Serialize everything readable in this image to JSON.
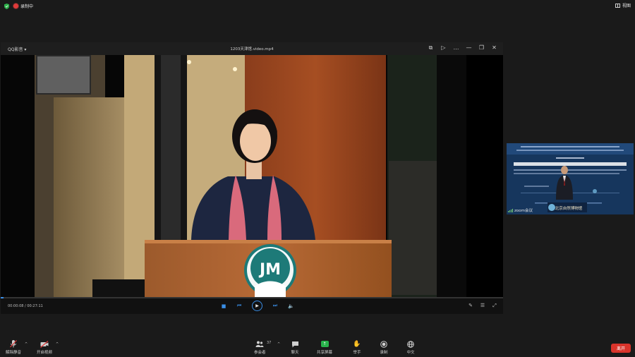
{
  "status_bar": {
    "recording_label": "录制中",
    "view_label": "视图"
  },
  "player": {
    "app_name": "QQ影音",
    "file_name": "1203天津馆.video.mp4",
    "time_current": "00:00:08",
    "time_total": "00:27:11",
    "progress": 0.005,
    "logo_text": "JM"
  },
  "thumbnail": {
    "label": "zoom会议",
    "banner_text": "北京自然博物馆"
  },
  "toolbar": {
    "unmute_label": "解除静音",
    "start_video_label": "开启视频",
    "participants_label": "参会者",
    "participants_count": "37",
    "chat_label": "聊天",
    "share_label": "共享屏幕",
    "raise_hand_label": "举手",
    "record_label": "录制",
    "language_label": "中文",
    "leave_label": "离开"
  },
  "colors": {
    "accent": "#3a8ee6",
    "share_green": "#28b34b",
    "leave_red": "#d9342b",
    "record_red": "#e03a3a"
  }
}
